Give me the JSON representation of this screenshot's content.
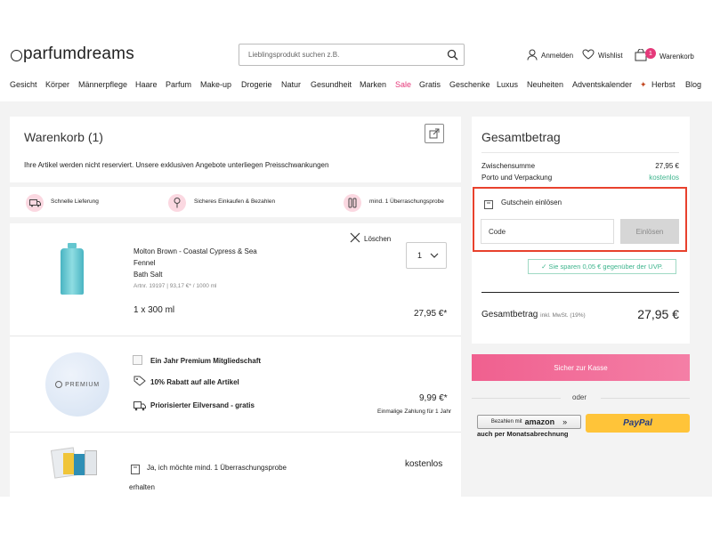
{
  "header": {
    "logo": "parfumdreams",
    "search_placeholder": "Lieblingsprodukt suchen z.B.",
    "login": "Anmelden",
    "wishlist": "Wishlist",
    "cart": "Warenkorb",
    "cart_count": "1"
  },
  "nav": [
    "Gesicht",
    "Körper",
    "Männerpflege",
    "Haare",
    "Parfum",
    "Make-up",
    "Drogerie",
    "Natur",
    "Gesundheit",
    "Marken",
    "Sale",
    "Gratis",
    "Geschenke",
    "Luxus",
    "Neuheiten",
    "Adventskalender",
    "Herbst",
    "Blog"
  ],
  "colors": {
    "accent": "#e5397a",
    "sale": "#e5397a",
    "highlight": "#e8412d",
    "paypal": "#ffc439"
  },
  "cart": {
    "title": "Warenkorb (1)",
    "notice": "Ihre Artikel werden nicht reserviert. Unsere exklusiven Angebote unterliegen Preisschwankungen",
    "features": [
      "Schnelle Lieferung",
      "Sicheres Einkaufen & Bezahlen",
      "mind. 1 Überraschungsprobe"
    ],
    "item": {
      "name_line1": "Molton Brown - Coastal Cypress & Sea",
      "name_line2": "Fennel",
      "type": "Bath Salt",
      "artnr": "Artnr. 19197 | 93,17 €* / 1000 ml",
      "size": "1 x 300 ml",
      "price": "27,95 €*",
      "qty": "1",
      "delete": "Löschen"
    },
    "premium": {
      "logo_text": "PREMIUM",
      "title": "Ein Jahr Premium Mitgliedschaft",
      "benefit1": "10% Rabatt auf alle Artikel",
      "benefit2": "Priorisierter Eilversand - gratis",
      "price": "9,99 €*",
      "note": "Einmalige Zahlung für 1 Jahr"
    },
    "sample": {
      "text_line1": "Ja, ich möchte mind. 1 Überraschungsprobe",
      "text_line2": "erhalten",
      "price": "kostenlos"
    }
  },
  "summary": {
    "title": "Gesamtbetrag",
    "subtotal_label": "Zwischensumme",
    "subtotal_value": "27,95 €",
    "shipping_label": "Porto und Verpackung",
    "shipping_value": "kostenlos",
    "voucher_label": "Gutschein einlösen",
    "code_placeholder": "Code",
    "redeem": "Einlösen",
    "savings": "✓ Sie sparen 0,05 € gegenüber der UVP.",
    "total_label": "Gesamtbetrag",
    "total_note": "inkl. MwSt. (19%)",
    "total_value": "27,95 €",
    "checkout": "Sicher zur Kasse",
    "or": "oder",
    "amazon_btn": "Bezahlen mit",
    "amazon_brand": "amazon",
    "paypal_brand": "PayPal",
    "monthly": "auch per Monatsabrechnung"
  }
}
